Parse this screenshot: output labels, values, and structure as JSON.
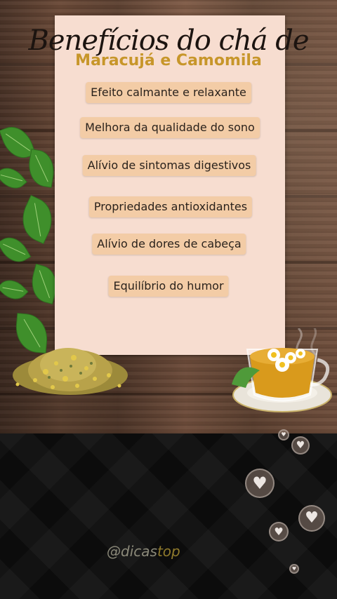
{
  "title": {
    "line1": "Benefícios do chá de",
    "line2": "Maracujá e Camomila"
  },
  "benefits": [
    "Efeito calmante e relaxante",
    "Melhora da qualidade do sono",
    "Alívio de sintomas digestivos",
    "Propriedades antioxidantes",
    "Alívio de dores de cabeça",
    "Equilíbrio do humor"
  ],
  "overlay": {
    "watermark_prefix": "@dicas",
    "watermark_suffix": "top",
    "reaction_icon": "heart-icon"
  },
  "colors": {
    "card": "#f7ddd0",
    "pill": "#f3cca6",
    "title_accent": "#c7962a"
  }
}
